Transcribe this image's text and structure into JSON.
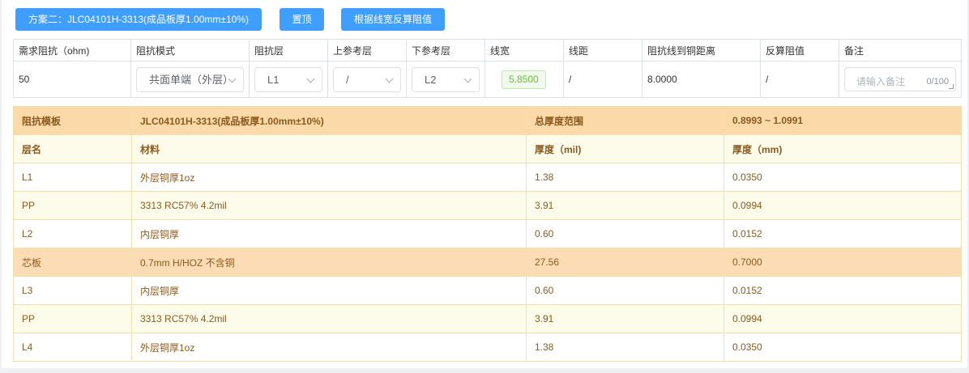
{
  "toolbar": {
    "scheme_label": "方案二：JLC04101H-3313(成品板厚1.00mm±10%)",
    "top_label": "置顶",
    "calc_label": "根据线宽反算阻值"
  },
  "params": {
    "headers": [
      "需求阻抗（ohm)",
      "阻抗模式",
      "阻抗层",
      "上参考层",
      "下参考层",
      "线宽",
      "线距",
      "阻抗线到铜距离",
      "反算阻值",
      "备注"
    ],
    "impedance": "50",
    "mode": "共面单端（外层）",
    "layer": "L1",
    "upper_ref": "/",
    "lower_ref": "L2",
    "line_width": "5.8500",
    "line_spacing": "/",
    "copper_distance": "8.0000",
    "back_calc": "/",
    "remark_placeholder": "请输入备注",
    "remark_count": "0/100"
  },
  "stackup": {
    "template_label": "阻抗模板",
    "template_value": "JLC04101H-3313(成品板厚1.00mm±10%)",
    "thickness_range_label": "总厚度范围",
    "thickness_range_value": "0.8993 ~ 1.0991",
    "columns": [
      "层名",
      "材料",
      "厚度（mil)",
      "厚度（mm)"
    ],
    "rows": [
      {
        "layer": "L1",
        "material": "外层铜厚1oz",
        "mil": "1.38",
        "mm": "0.0350"
      },
      {
        "layer": "PP",
        "material": "3313 RC57% 4.2mil",
        "mil": "3.91",
        "mm": "0.0994"
      },
      {
        "layer": "L2",
        "material": "内层铜厚",
        "mil": "0.60",
        "mm": "0.0152"
      },
      {
        "layer": "芯板",
        "material": "0.7mm H/HOZ 不含铜",
        "mil": "27.56",
        "mm": "0.7000"
      },
      {
        "layer": "L3",
        "material": "内层铜厚",
        "mil": "0.60",
        "mm": "0.0152"
      },
      {
        "layer": "PP",
        "material": "3313 RC57% 4.2mil",
        "mil": "3.91",
        "mm": "0.0994"
      },
      {
        "layer": "L4",
        "material": "外层铜厚1oz",
        "mil": "1.38",
        "mm": "0.0350"
      }
    ]
  },
  "colors": {
    "primary": "#409eff",
    "header_bg": "#fbd9a8",
    "core_row_bg": "#fbdcb4",
    "alt_row_bg": "#fdfbe9",
    "text_brown": "#8a5a1e",
    "success_green": "#67c23a"
  }
}
